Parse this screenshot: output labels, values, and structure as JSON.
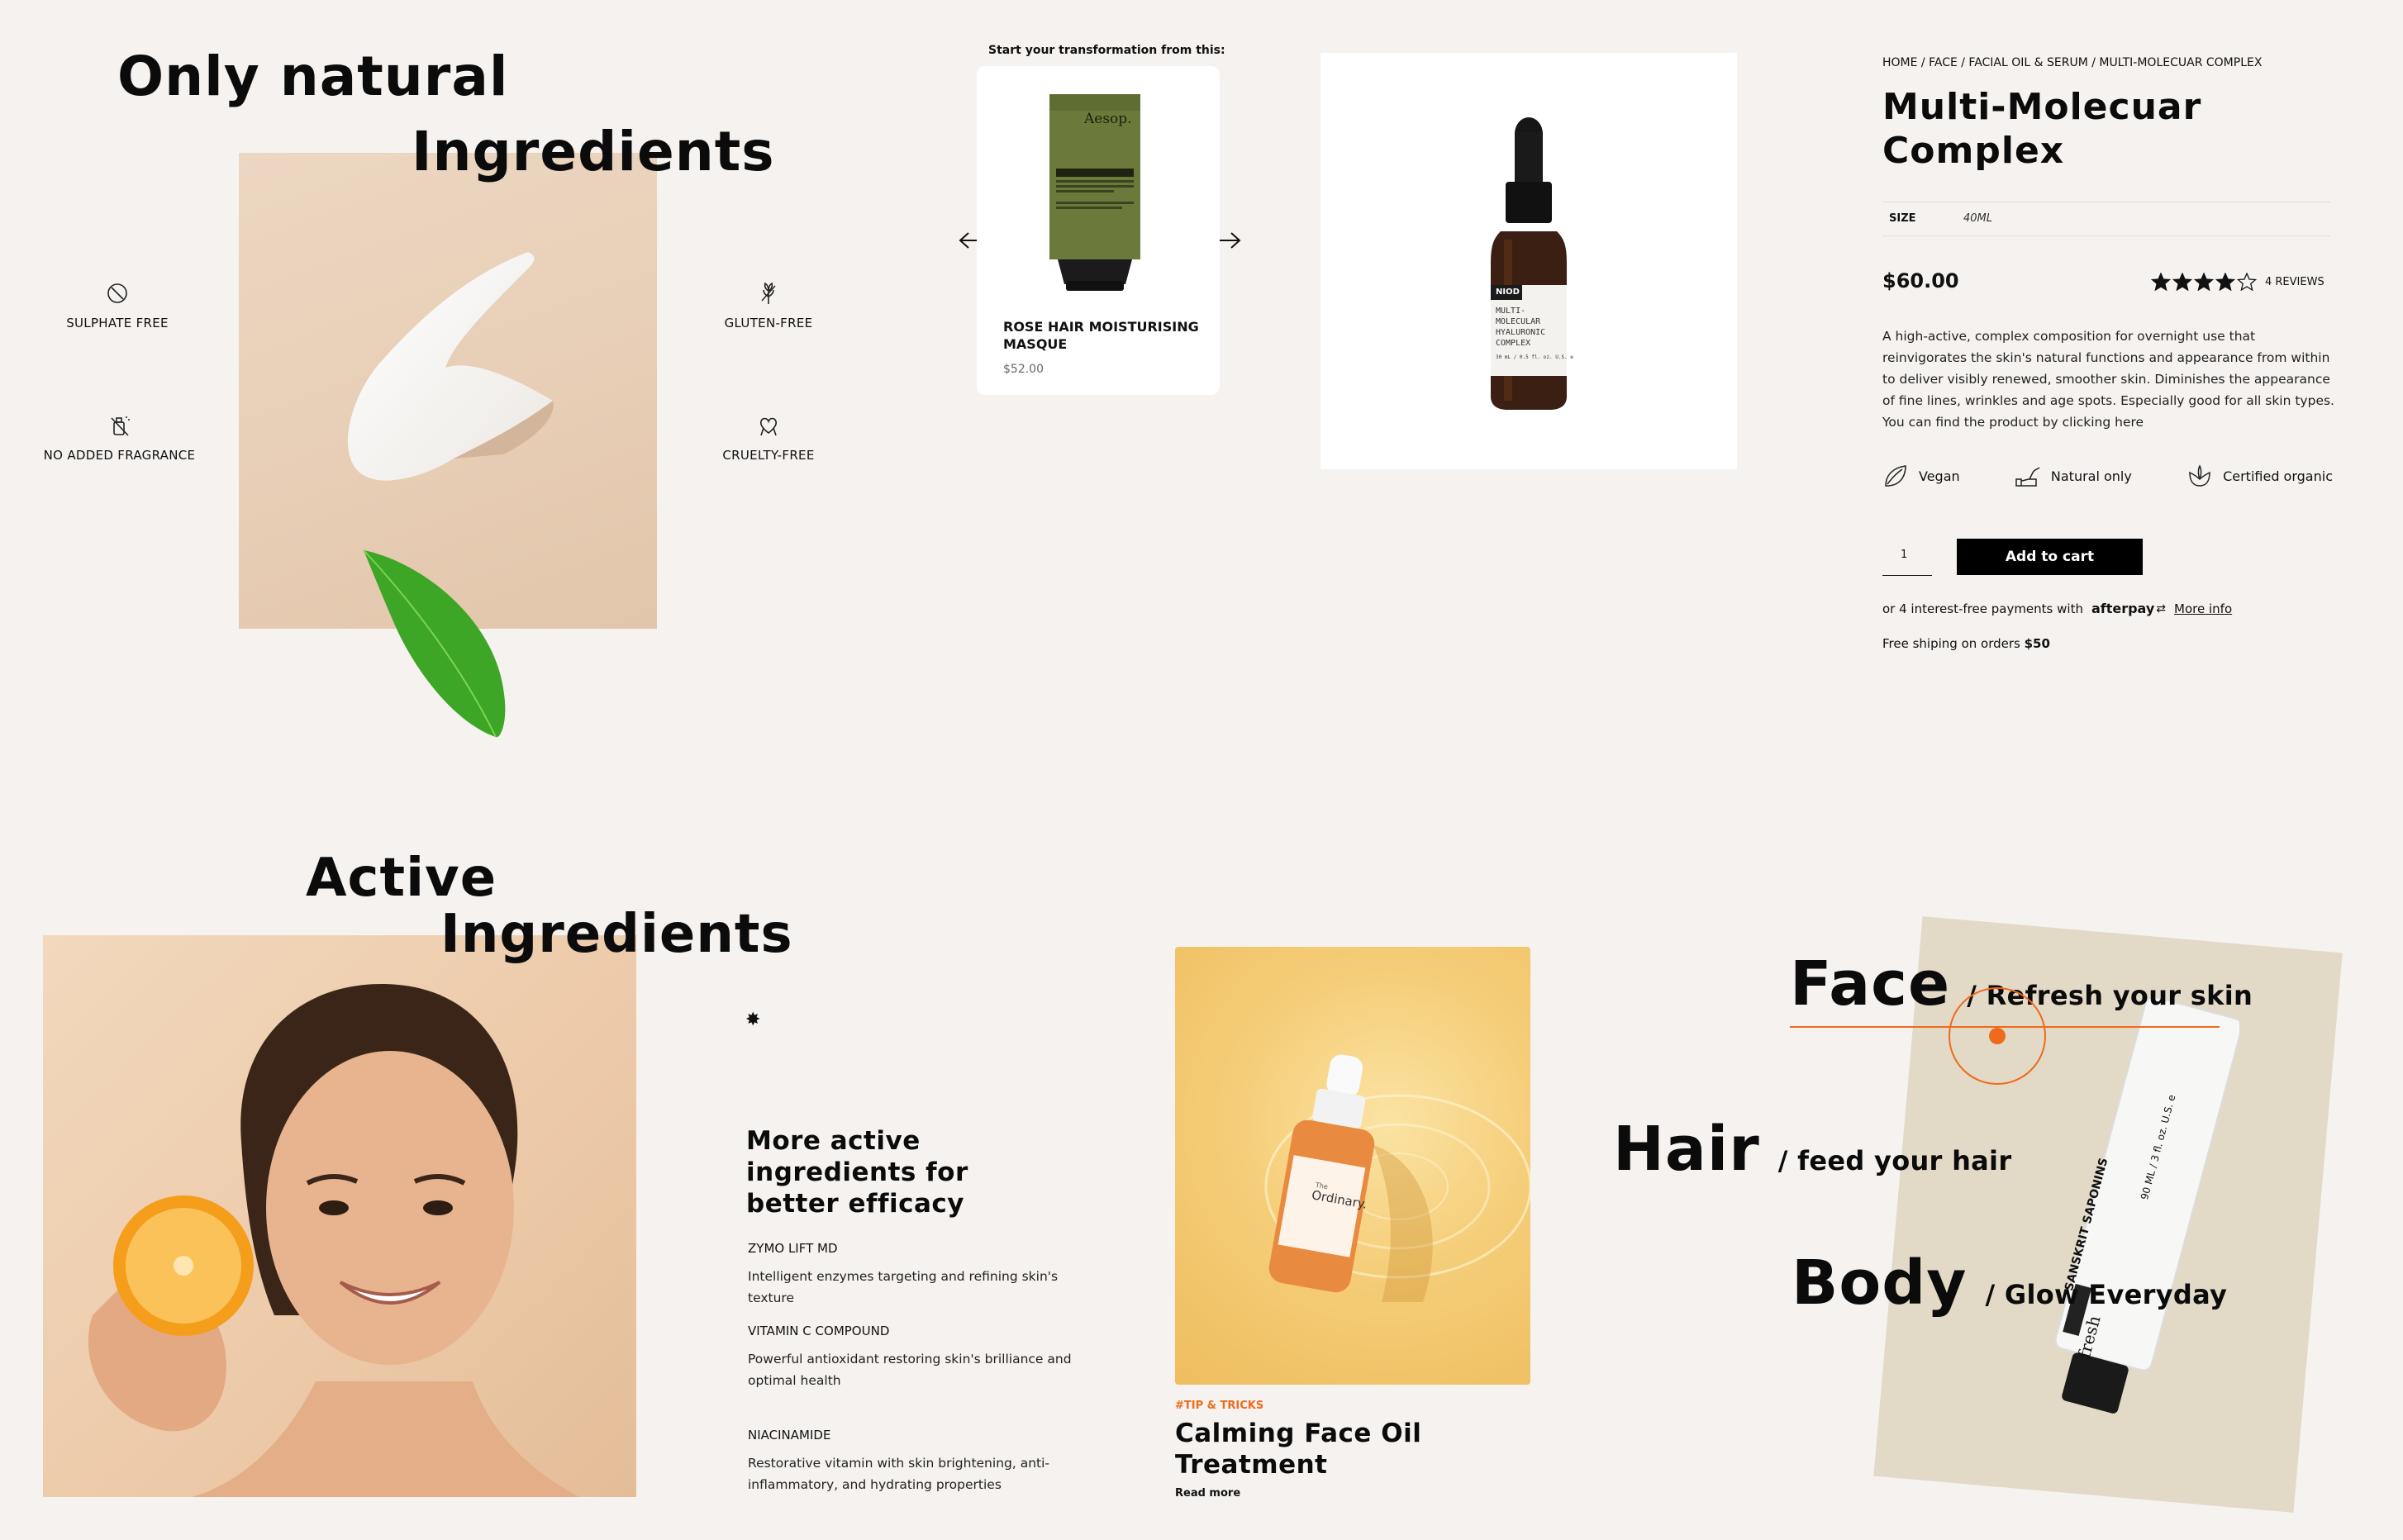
{
  "natural": {
    "title_line1": "Only natural",
    "title_line2": "Ingredients",
    "features": [
      {
        "label": "SULPHATE FREE",
        "icon": "no-sulphate-icon"
      },
      {
        "label": "GLUTEN-FREE",
        "icon": "wheat-icon"
      },
      {
        "label": "NO ADDED FRAGRANCE",
        "icon": "no-fragrance-icon"
      },
      {
        "label": "CRUELTY-FREE",
        "icon": "heart-hands-icon"
      }
    ]
  },
  "carousel": {
    "heading": "Start your transformation from this:",
    "product_name_line1": "ROSE HAIR MOISTURISING",
    "product_name_line2": "MASQUE",
    "price": "$52.00",
    "tube_brand": "Aesop."
  },
  "bottle_label": {
    "brand": "NIOD",
    "line1": "MULTI-",
    "line2": "MOLECULAR",
    "line3": "HYALURONIC",
    "line4": "COMPLEX",
    "line5": "30 mL / 0.5 fl. oz. U.S. e"
  },
  "product": {
    "breadcrumb": "HOME / FACE / FACIAL OIL & SERUM / MULTI-MOLECUAR COMPLEX",
    "title_line1": "Multi-Molecuar",
    "title_line2": "Complex",
    "size_label": "SIZE",
    "size_value": "40ML",
    "price": "$60.00",
    "rating": 4,
    "rating_max": 5,
    "reviews": "4 REVIEWS",
    "description": "A high-active, complex composition for overnight use that reinvigorates the skin's natural functions and appearance from within to deliver visibly renewed, smoother skin. Diminishes the appearance of fine lines, wrinkles and age spots. Especially good for all skin types. You can find the product by clicking here",
    "attributes": [
      {
        "label": "Vegan",
        "icon": "leaf-icon"
      },
      {
        "label": "Natural only",
        "icon": "hand-icon"
      },
      {
        "label": "Certified organic",
        "icon": "lotus-icon"
      }
    ],
    "quantity": "1",
    "add_to_cart": "Add to cart",
    "afterpay_text": "or 4 interest-free payments with",
    "afterpay_brand": "afterpay",
    "more_info": "More info",
    "shipping_text": "Free shiping on orders",
    "shipping_amount": "$50"
  },
  "active": {
    "title_line1": "Active",
    "title_line2": "Ingredients",
    "heading_line1": "More active",
    "heading_line2": "ingredients for",
    "heading_line3": "better efficacy",
    "items": [
      {
        "name": "ZYMO LIFT MD",
        "desc_line1": "Intelligent enzymes targeting and refining skin's texture",
        "desc_line2": ""
      },
      {
        "name": "VITAMIN C COMPOUND",
        "desc_line1": "Powerful antioxidant restoring skin's brilliance and",
        "desc_line2": "optimal health"
      },
      {
        "name": "NIACINAMIDE",
        "desc_line1": "Restorative vitamin with skin brightening, anti-",
        "desc_line2": "inflammatory, and hydrating properties"
      }
    ]
  },
  "blog": {
    "tag": "#TIP & TRICKS",
    "title_line1": "Calming Face Oil",
    "title_line2": "Treatment",
    "read_more": "Read more",
    "bottle_brand_small": "The",
    "bottle_brand": "Ordinary."
  },
  "categories": {
    "items": [
      {
        "name": "Face",
        "tagline": "/ Refresh your skin"
      },
      {
        "name": "Hair",
        "tagline": "/ feed your hair"
      },
      {
        "name": "Body",
        "tagline": "/ Glow Everyday"
      }
    ],
    "tube_text1": "SANSKRIT SAPONINS",
    "tube_text2": "90 ML / 3 fl. oz. U.S. e",
    "tube_brand": "fresh",
    "accent_color": "#f06a1d"
  },
  "colors": {
    "background": "#f5f2ef",
    "accent": "#f06a1d",
    "text": "#0b0b0b"
  }
}
